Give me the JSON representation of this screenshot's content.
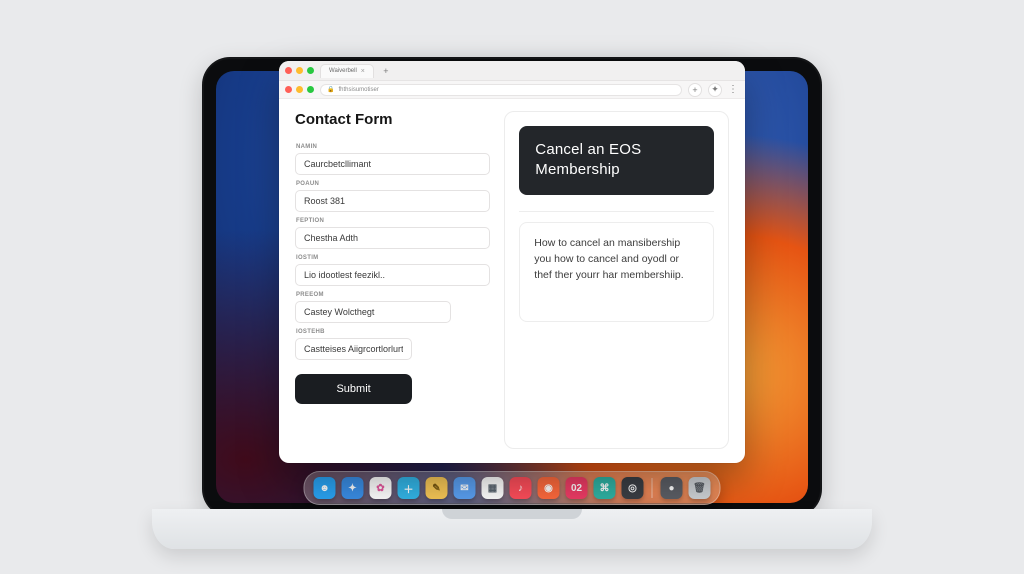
{
  "browser": {
    "tab_title": "Waiverbell",
    "url_text": "fhthsisumotiser",
    "new_tab_tooltip": "+",
    "plus_button_tooltip": "+"
  },
  "page": {
    "title": "Contact Form",
    "fields": [
      {
        "label": "Namin",
        "value": "Caurcbetcllimant"
      },
      {
        "label": "Poaun",
        "value": "Roost 381"
      },
      {
        "label": "Feption",
        "value": "Chestha Adth"
      },
      {
        "label": "Iostim",
        "value": "Lio idootlest feezikl.."
      },
      {
        "label": "Preeom",
        "value": "Castey Wolcthegt"
      },
      {
        "label": "Iostehb",
        "value": "Castteises Aiigrcortlorlurtsr."
      }
    ],
    "submit_label": "Submit",
    "hero_title": "Cancel an EOS Membership",
    "description": "How to cancel an mansibership you how to cancel and oyodl or thef ther yourr har membershiip."
  },
  "dock": {
    "apps": [
      {
        "name": "finder",
        "bg": "#2aa4f4",
        "glyph": "☻"
      },
      {
        "name": "safari",
        "bg": "#3a8ee6",
        "glyph": "✦"
      },
      {
        "name": "photos",
        "bg": "#ffffff",
        "glyph": "✿",
        "fg": "#e65aa0"
      },
      {
        "name": "add",
        "bg": "#33b6e8",
        "glyph": "＋"
      },
      {
        "name": "notes",
        "bg": "#f7c857",
        "glyph": "✎",
        "fg": "#7a5a13"
      },
      {
        "name": "mail",
        "bg": "#5aa0f2",
        "glyph": "✉"
      },
      {
        "name": "cal",
        "bg": "#ffffff",
        "glyph": "▦",
        "fg": "#5a6570"
      },
      {
        "name": "music",
        "bg": "#ff4e5b",
        "glyph": "♪"
      },
      {
        "name": "app1",
        "bg": "#ff6a3d",
        "glyph": "◉"
      },
      {
        "name": "app2",
        "bg": "#ef3c66",
        "glyph": "02"
      },
      {
        "name": "app3",
        "bg": "#2fb3a4",
        "glyph": "⌘"
      },
      {
        "name": "app4",
        "bg": "#3b3f45",
        "glyph": "◎"
      },
      {
        "name": "app5",
        "bg": "#5c5f66",
        "glyph": "●"
      },
      {
        "name": "trash",
        "bg": "#cfd3d7",
        "glyph": "🗑",
        "fg": "#5a5f66"
      }
    ]
  }
}
